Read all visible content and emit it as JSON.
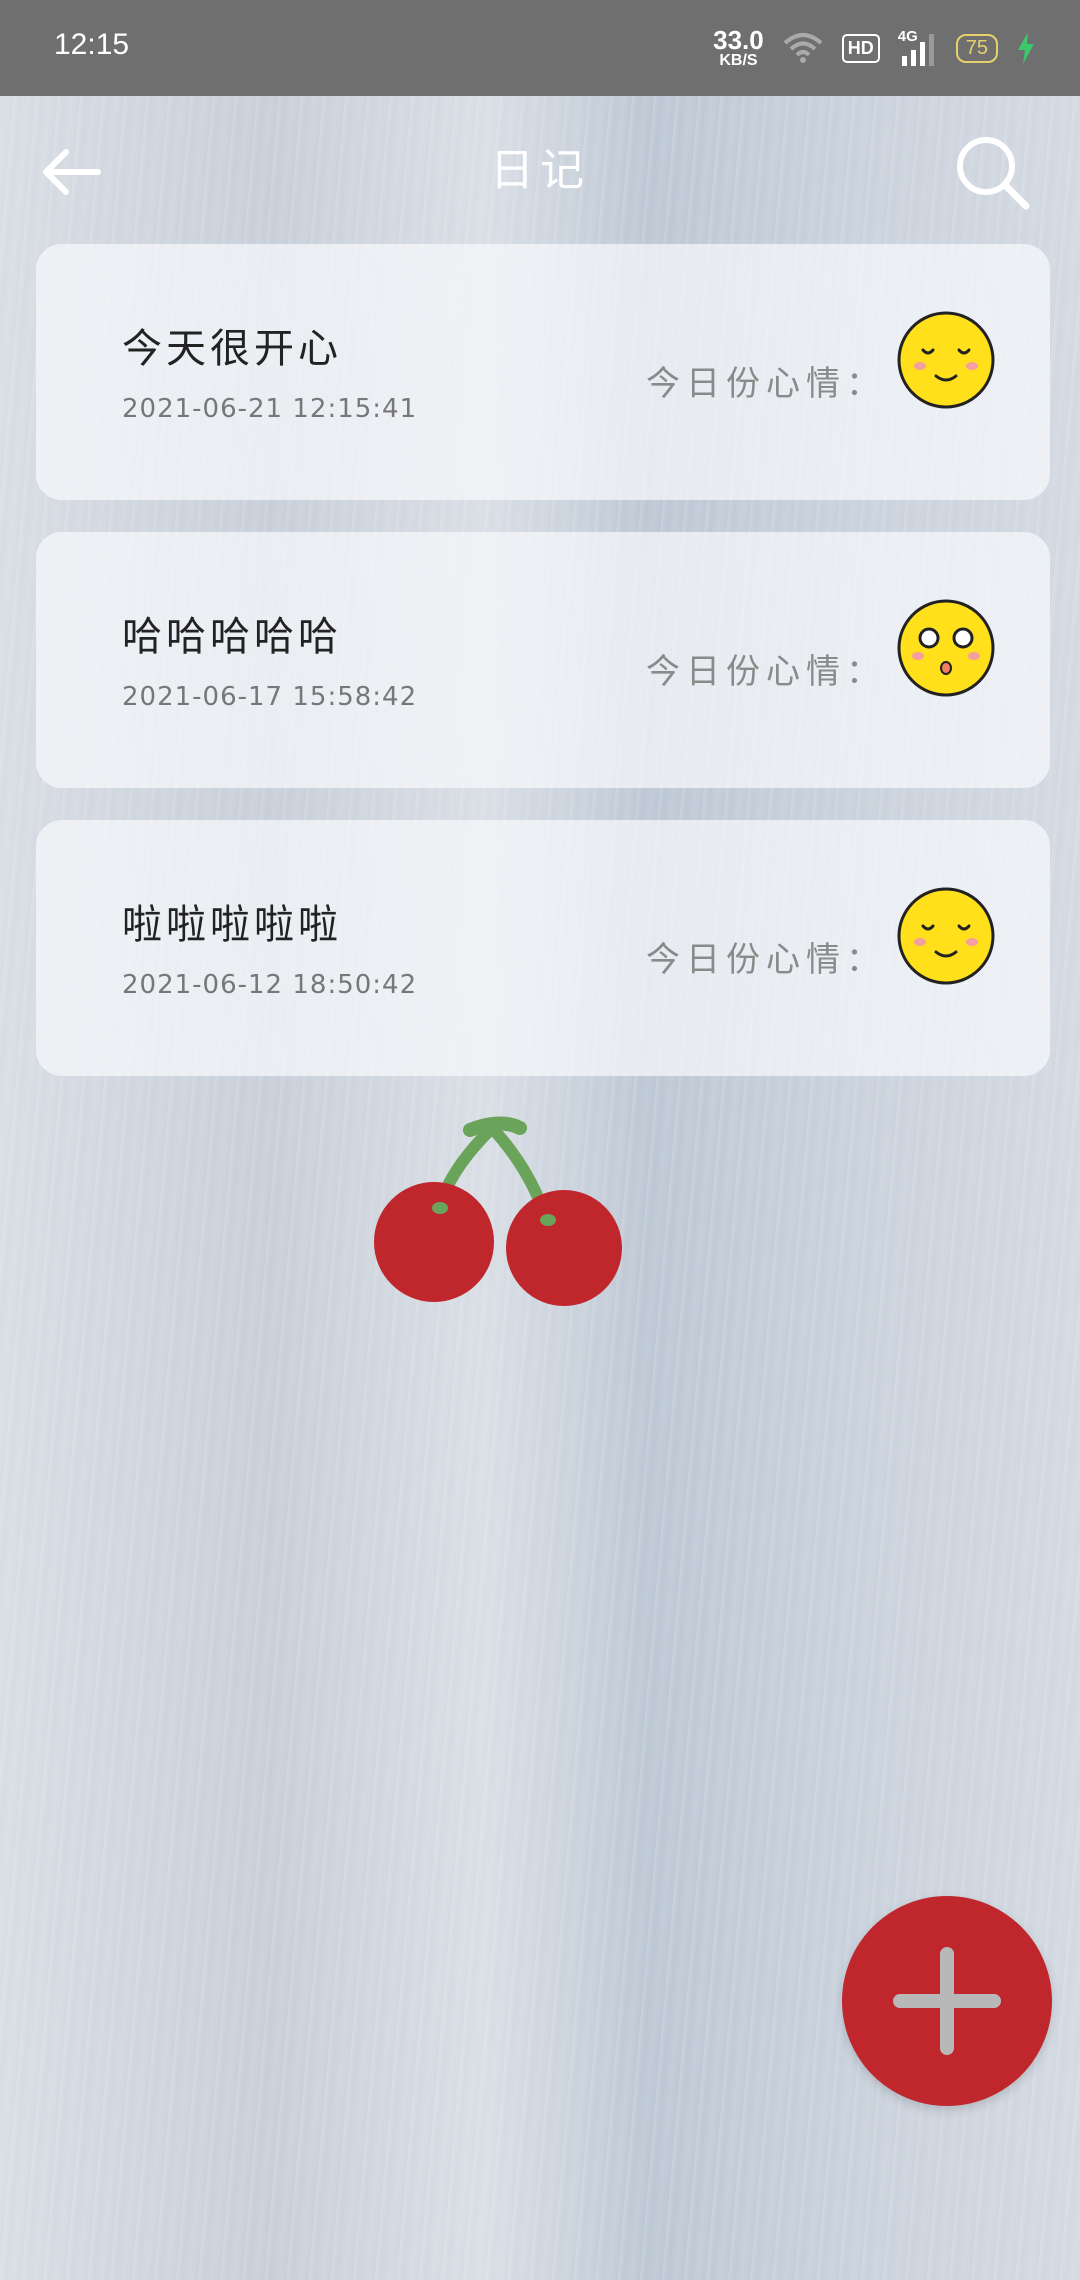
{
  "status_bar": {
    "time": "12:15",
    "net_speed_value": "33.0",
    "net_speed_unit": "KB/S",
    "hd": "HD",
    "signal": "4G",
    "battery": "75"
  },
  "header": {
    "title": "日记",
    "back_icon": "arrow-left-icon",
    "search_icon": "search-icon"
  },
  "entries": [
    {
      "title": "今天很开心",
      "date": "2021-06-21 12:15:41",
      "mood_label": "今日份心情：",
      "mood": "smile"
    },
    {
      "title": "哈哈哈哈哈",
      "date": "2021-06-17 15:58:42",
      "mood_label": "今日份心情：",
      "mood": "surprised"
    },
    {
      "title": "啦啦啦啦啦",
      "date": "2021-06-12 18:50:42",
      "mood_label": "今日份心情：",
      "mood": "smile"
    }
  ],
  "fab": {
    "icon": "plus-icon",
    "color": "#c0272d"
  },
  "colors": {
    "status_bar": "#6f6f6f",
    "mood_face": "#ffe01a",
    "accent": "#c0272d"
  }
}
